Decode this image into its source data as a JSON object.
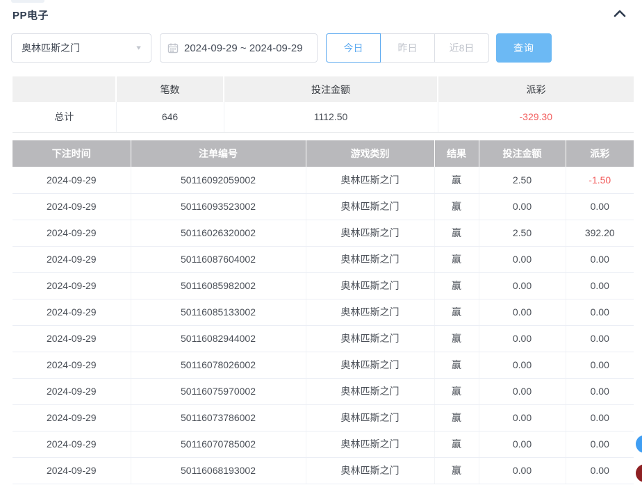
{
  "panel": {
    "title": "PP电子"
  },
  "filters": {
    "game_select": {
      "value": "奥林匹斯之门"
    },
    "date_range": {
      "value": "2024-09-29 ~ 2024-09-29"
    },
    "quick_buttons": [
      {
        "label": "今日",
        "active": true
      },
      {
        "label": "昨日",
        "active": false
      },
      {
        "label": "近8日",
        "active": false
      }
    ],
    "search_button": "查询"
  },
  "summary_table": {
    "headers": [
      "",
      "笔数",
      "投注金额",
      "派彩"
    ],
    "row": {
      "label": "总计",
      "count": "646",
      "bet_amount": "1112.50",
      "payout": "-329.30"
    }
  },
  "records_table": {
    "headers": [
      "下注时间",
      "注单编号",
      "游戏类别",
      "结果",
      "投注金额",
      "派彩"
    ],
    "rows": [
      {
        "date": "2024-09-29",
        "bet_id": "50116092059002",
        "game": "奥林匹斯之门",
        "result": "赢",
        "bet_amount": "2.50",
        "payout": "-1.50"
      },
      {
        "date": "2024-09-29",
        "bet_id": "50116093523002",
        "game": "奥林匹斯之门",
        "result": "赢",
        "bet_amount": "0.00",
        "payout": "0.00"
      },
      {
        "date": "2024-09-29",
        "bet_id": "50116026320002",
        "game": "奥林匹斯之门",
        "result": "赢",
        "bet_amount": "2.50",
        "payout": "392.20"
      },
      {
        "date": "2024-09-29",
        "bet_id": "50116087604002",
        "game": "奥林匹斯之门",
        "result": "赢",
        "bet_amount": "0.00",
        "payout": "0.00"
      },
      {
        "date": "2024-09-29",
        "bet_id": "50116085982002",
        "game": "奥林匹斯之门",
        "result": "赢",
        "bet_amount": "0.00",
        "payout": "0.00"
      },
      {
        "date": "2024-09-29",
        "bet_id": "50116085133002",
        "game": "奥林匹斯之门",
        "result": "赢",
        "bet_amount": "0.00",
        "payout": "0.00"
      },
      {
        "date": "2024-09-29",
        "bet_id": "50116082944002",
        "game": "奥林匹斯之门",
        "result": "赢",
        "bet_amount": "0.00",
        "payout": "0.00"
      },
      {
        "date": "2024-09-29",
        "bet_id": "50116078026002",
        "game": "奥林匹斯之门",
        "result": "赢",
        "bet_amount": "0.00",
        "payout": "0.00"
      },
      {
        "date": "2024-09-29",
        "bet_id": "50116075970002",
        "game": "奥林匹斯之门",
        "result": "赢",
        "bet_amount": "0.00",
        "payout": "0.00"
      },
      {
        "date": "2024-09-29",
        "bet_id": "50116073786002",
        "game": "奥林匹斯之门",
        "result": "赢",
        "bet_amount": "0.00",
        "payout": "0.00"
      },
      {
        "date": "2024-09-29",
        "bet_id": "50116070785002",
        "game": "奥林匹斯之门",
        "result": "赢",
        "bet_amount": "0.00",
        "payout": "0.00"
      },
      {
        "date": "2024-09-29",
        "bet_id": "50116068193002",
        "game": "奥林匹斯之门",
        "result": "赢",
        "bet_amount": "0.00",
        "payout": "0.00"
      }
    ]
  },
  "colors": {
    "accent_blue": "#5fabf0",
    "search_button_blue": "#6cb9f4",
    "negative_red": "#f25c5c",
    "records_header_bg": "#b9b9bc",
    "summary_header_bg": "#f0f0f0",
    "title_navy": "#2e3b4e"
  }
}
